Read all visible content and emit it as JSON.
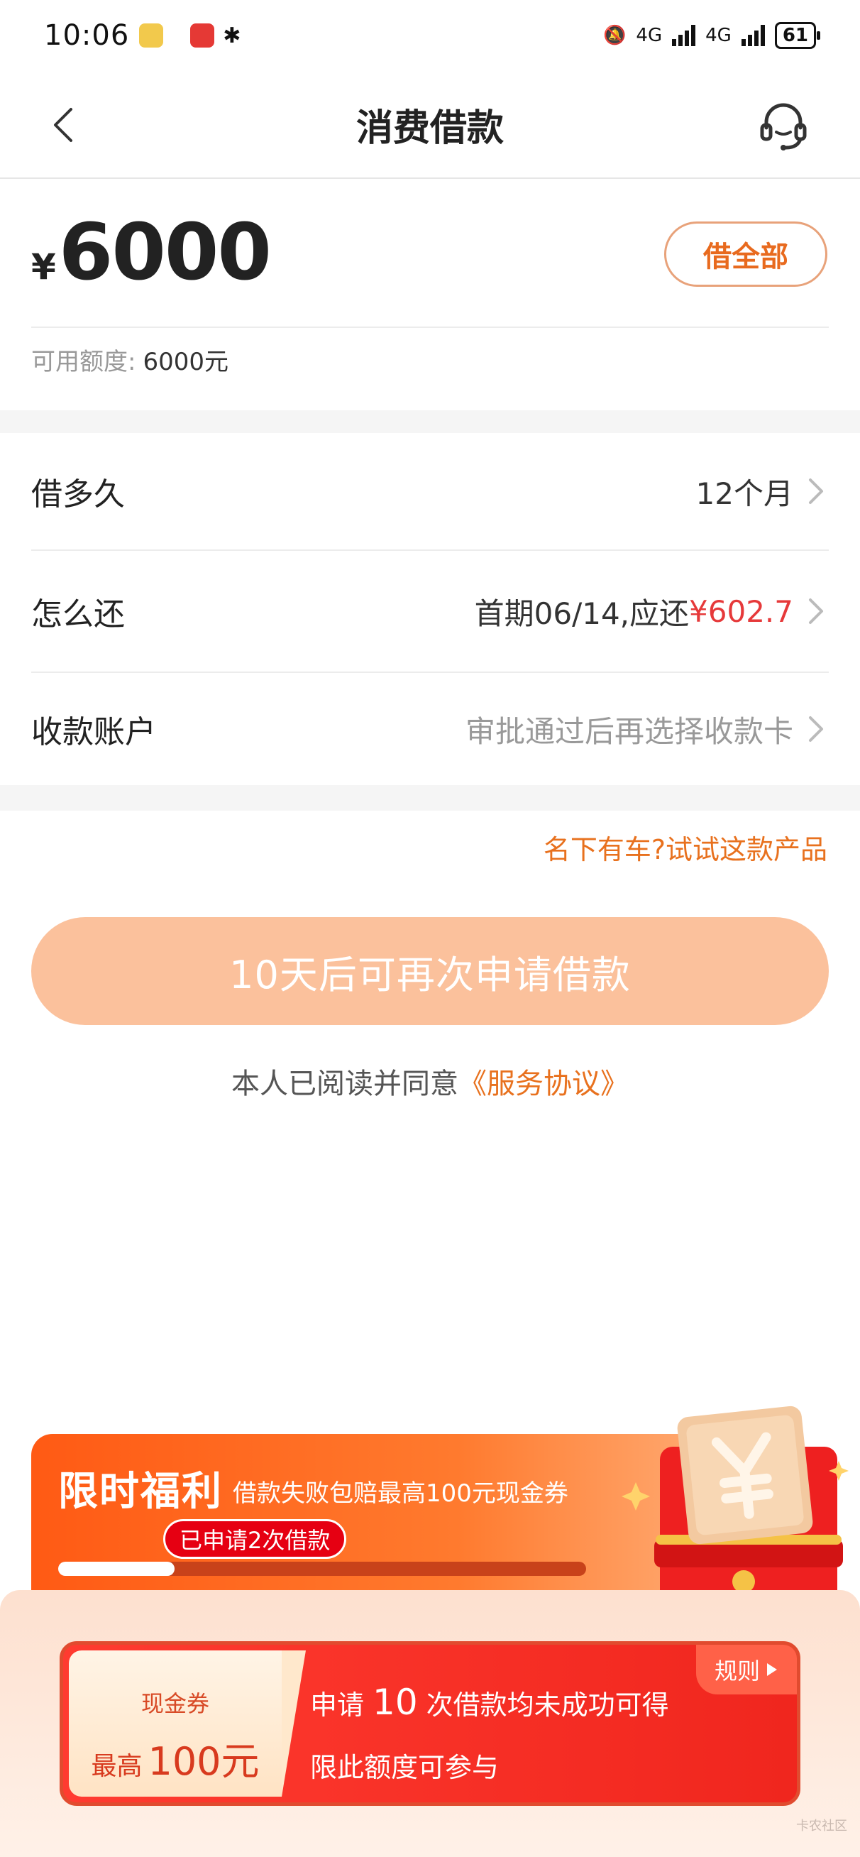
{
  "status_bar": {
    "time": "10:06",
    "network1": "4G",
    "network2": "4G",
    "battery": "61"
  },
  "nav": {
    "title": "消费借款"
  },
  "amount": {
    "currency": "¥",
    "value": "6000",
    "borrow_all_label": "借全部",
    "credit_label": "可用额度:",
    "credit_value": "6000元"
  },
  "rows": {
    "duration": {
      "label": "借多久",
      "value": "12个月"
    },
    "repay": {
      "label": "怎么还",
      "value_prefix": "首期06/14,应还",
      "value_amount": "¥602.7"
    },
    "account": {
      "label": "收款账户",
      "value": "审批通过后再选择收款卡"
    }
  },
  "car_link": "名下有车?试试这款产品",
  "apply_button": "10天后可再次申请借款",
  "agreement": {
    "text": "本人已阅读并同意",
    "link": "《服务协议》"
  },
  "promo": {
    "title": "限时福利",
    "subtitle": "借款失败包赔最高100元现金券",
    "badge": "已申请2次借款",
    "progress": 0.22
  },
  "coupon": {
    "name": "现金券",
    "prefix": "最高",
    "value": "100元",
    "rules": "规则",
    "line1_prefix": "申请",
    "line1_count": "10",
    "line1_suffix": "次借款均未成功可得",
    "line2": "限此额度可参与"
  },
  "colors": {
    "accent": "#e8711e",
    "button_disabled": "#fbc19c",
    "price_red": "#e6393a",
    "promo_orange": "#ff5a14"
  }
}
